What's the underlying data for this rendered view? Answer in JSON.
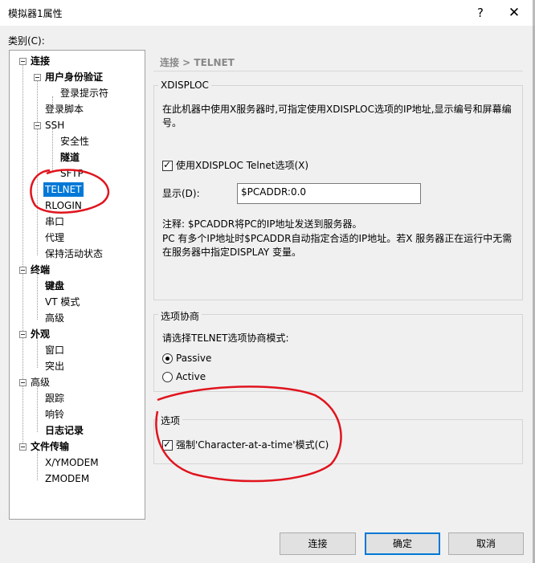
{
  "window": {
    "title": "模拟器1属性",
    "help": "?",
    "close": "✕"
  },
  "category_label": "类别(C):",
  "tree": [
    {
      "label": "连接",
      "bold": true
    },
    {
      "label": "用户身份验证",
      "bold": true
    },
    {
      "label": "登录提示符",
      "bold": false
    },
    {
      "label": "登录脚本",
      "bold": false
    },
    {
      "label": "SSH",
      "bold": false
    },
    {
      "label": "安全性",
      "bold": false
    },
    {
      "label": "隧道",
      "bold": true
    },
    {
      "label": "SFTP",
      "bold": false
    },
    {
      "label": "TELNET",
      "bold": false,
      "selected": true
    },
    {
      "label": "RLOGIN",
      "bold": false
    },
    {
      "label": "串口",
      "bold": false
    },
    {
      "label": "代理",
      "bold": false
    },
    {
      "label": "保持活动状态",
      "bold": false
    },
    {
      "label": "终端",
      "bold": true
    },
    {
      "label": "键盘",
      "bold": true
    },
    {
      "label": "VT 模式",
      "bold": false
    },
    {
      "label": "高级",
      "bold": false
    },
    {
      "label": "外观",
      "bold": true
    },
    {
      "label": "窗口",
      "bold": false
    },
    {
      "label": "突出",
      "bold": false
    },
    {
      "label": "高级",
      "bold": false
    },
    {
      "label": "跟踪",
      "bold": false
    },
    {
      "label": "响铃",
      "bold": false
    },
    {
      "label": "日志记录",
      "bold": true
    },
    {
      "label": "文件传输",
      "bold": true
    },
    {
      "label": "X/YMODEM",
      "bold": false
    },
    {
      "label": "ZMODEM",
      "bold": false
    }
  ],
  "breadcrumb": "连接 > TELNET",
  "xdisploc": {
    "title": "XDISPLOC",
    "description_line1": "在此机器中使用X服务器时,可指定使用XDISPLOC选项的IP地址,显示编号和屏幕编",
    "description_line2": "号。",
    "checkbox_label": "使用XDISPLOC Telnet选项(X)",
    "checkbox_checked": true,
    "display_label": "显示(D):",
    "display_value": "$PCADDR:0.0",
    "note_line1": "注释: $PCADDR将PC的IP地址发送到服务器。",
    "note_line2": "PC 有多个IP地址时$PCADDR自动指定合适的IP地址。若X 服务器正在运行中无需",
    "note_line3": "在服务器中指定DISPLAY 变量。"
  },
  "negotiation": {
    "title": "选项协商",
    "prompt": "请选择TELNET选项协商模式:",
    "options": [
      {
        "label": "Passive",
        "selected": true
      },
      {
        "label": "Active",
        "selected": false
      }
    ]
  },
  "options_group": {
    "title": "选项",
    "checkbox_label": "强制'Character-at-a-time'模式(C)",
    "checkbox_checked": true
  },
  "buttons": {
    "connect": "连接",
    "ok": "确定",
    "cancel": "取消"
  },
  "annotation_color": "#e0141e",
  "selection_color": "#0078d7"
}
